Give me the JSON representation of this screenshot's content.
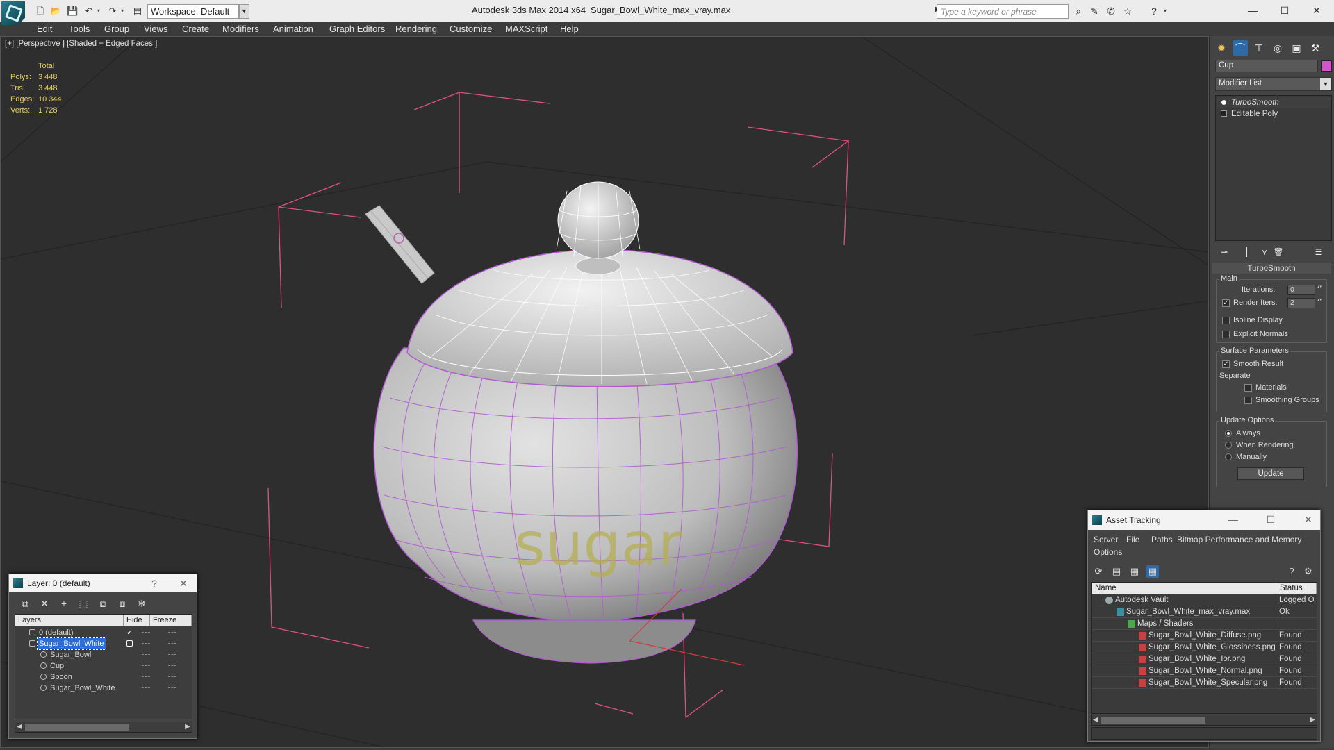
{
  "titlebar": {
    "workspace": "Workspace: Default",
    "app_title": "Autodesk 3ds Max  2014 x64",
    "file_title": "Sugar_Bowl_White_max_vray.max",
    "search_placeholder": "Type a keyword or phrase"
  },
  "menu": [
    "Edit",
    "Tools",
    "Group",
    "Views",
    "Create",
    "Modifiers",
    "Animation",
    "Graph Editors",
    "Rendering",
    "Customize",
    "MAXScript",
    "Help"
  ],
  "viewport": {
    "label": "[+] [Perspective ] [Shaded + Edged Faces ]",
    "stats": {
      "header": "Total",
      "rows": [
        {
          "label": "Polys:",
          "value": "3 448"
        },
        {
          "label": "Tris:",
          "value": "3 448"
        },
        {
          "label": "Edges:",
          "value": "10 344"
        },
        {
          "label": "Verts:",
          "value": "1 728"
        }
      ]
    },
    "model_text": "sugar"
  },
  "command_panel": {
    "object_name": "Cup",
    "object_color": "#d256c9",
    "modifier_list": "Modifier List",
    "stack": [
      "TurboSmooth",
      "Editable Poly"
    ],
    "turbosmooth": {
      "title": "TurboSmooth",
      "main_label": "Main",
      "iterations_label": "Iterations:",
      "iterations_value": "0",
      "render_iters_label": "Render Iters:",
      "render_iters_value": "2",
      "render_iters_checked": true,
      "isoline_label": "Isoline Display",
      "explicit_normals_label": "Explicit Normals",
      "surface_label": "Surface Parameters",
      "smooth_result_label": "Smooth Result",
      "separate_label": "Separate",
      "materials_label": "Materials",
      "smoothing_groups_label": "Smoothing Groups",
      "update_options_label": "Update Options",
      "always_label": "Always",
      "when_rendering_label": "When Rendering",
      "manually_label": "Manually",
      "update_button": "Update"
    }
  },
  "layer_dialog": {
    "title": "Layer: 0 (default)",
    "help": "?",
    "columns": {
      "layers": "Layers",
      "hide": "Hide",
      "freeze": "Freeze"
    },
    "rows": [
      {
        "name": "0 (default)",
        "indent": 1,
        "active": true
      },
      {
        "name": "Sugar_Bowl_White",
        "indent": 1,
        "selected": true
      },
      {
        "name": "Sugar_Bowl",
        "indent": 2
      },
      {
        "name": "Cup",
        "indent": 2
      },
      {
        "name": "Spoon",
        "indent": 2
      },
      {
        "name": "Sugar_Bowl_White",
        "indent": 2
      }
    ]
  },
  "asset_tracking": {
    "title": "Asset Tracking",
    "menu": [
      "Server",
      "File",
      "Paths",
      "Bitmap Performance and Memory",
      "Options"
    ],
    "columns": {
      "name": "Name",
      "status": "Status"
    },
    "rows": [
      {
        "name": "Autodesk Vault",
        "status": "Logged O",
        "indent": 1,
        "icon": "vault"
      },
      {
        "name": "Sugar_Bowl_White_max_vray.max",
        "status": "Ok",
        "indent": 2,
        "icon": "max"
      },
      {
        "name": "Maps / Shaders",
        "status": "",
        "indent": 3,
        "icon": "maps"
      },
      {
        "name": "Sugar_Bowl_White_Diffuse.png",
        "status": "Found",
        "indent": 4,
        "icon": "png"
      },
      {
        "name": "Sugar_Bowl_White_Glossiness.png",
        "status": "Found",
        "indent": 4,
        "icon": "png"
      },
      {
        "name": "Sugar_Bowl_White_Ior.png",
        "status": "Found",
        "indent": 4,
        "icon": "png"
      },
      {
        "name": "Sugar_Bowl_White_Normal.png",
        "status": "Found",
        "indent": 4,
        "icon": "png"
      },
      {
        "name": "Sugar_Bowl_White_Specular.png",
        "status": "Found",
        "indent": 4,
        "icon": "png"
      }
    ]
  }
}
